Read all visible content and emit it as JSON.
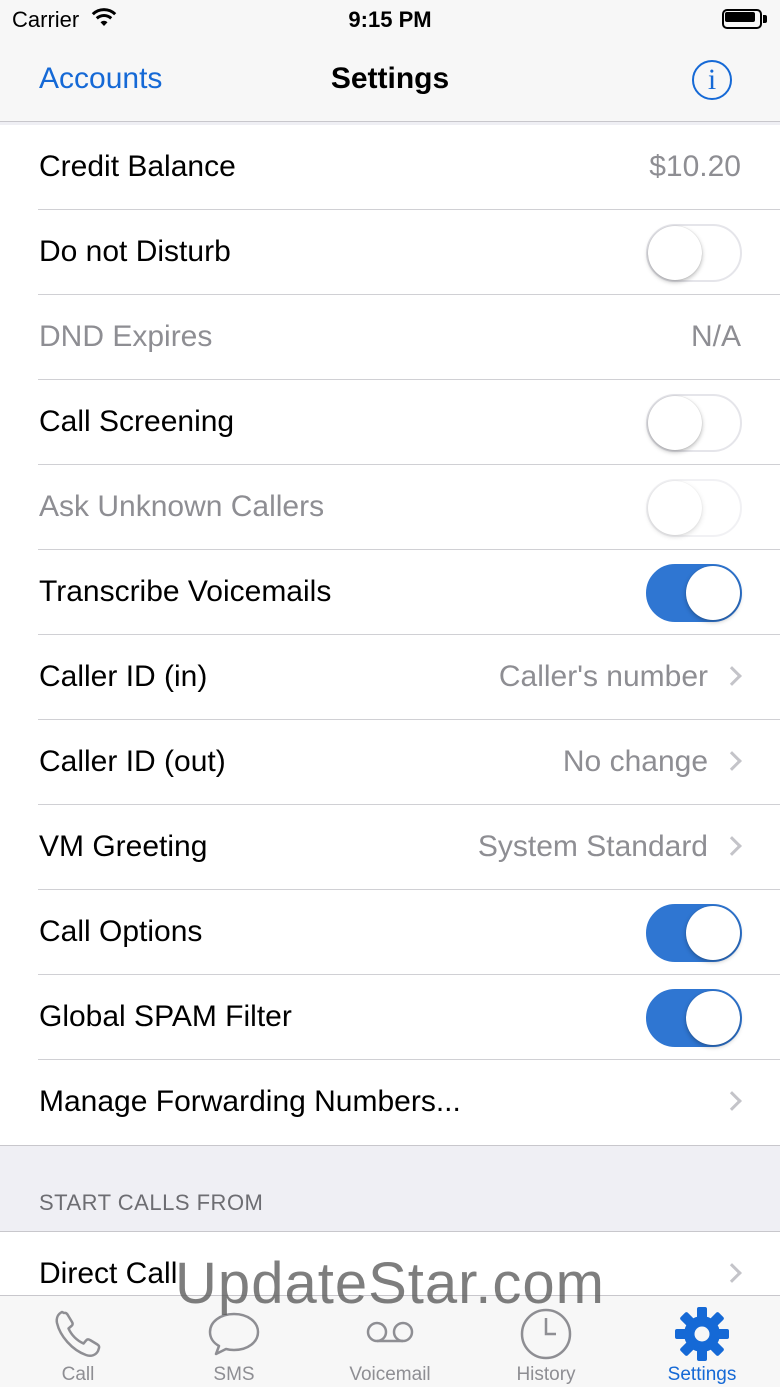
{
  "status": {
    "carrier": "Carrier",
    "time": "9:15 PM"
  },
  "nav": {
    "back_label": "Accounts",
    "title": "Settings",
    "info_glyph": "i"
  },
  "settings": [
    {
      "label": "Credit Balance",
      "value": "$10.20",
      "type": "value"
    },
    {
      "label": "Do not Disturb",
      "type": "toggle",
      "on": false
    },
    {
      "label": "DND Expires",
      "value": "N/A",
      "type": "value",
      "disabled": true
    },
    {
      "label": "Call Screening",
      "type": "toggle",
      "on": false
    },
    {
      "label": "Ask Unknown Callers",
      "type": "toggle",
      "on": false,
      "disabled": true
    },
    {
      "label": "Transcribe Voicemails",
      "type": "toggle",
      "on": true
    },
    {
      "label": "Caller ID (in)",
      "value": "Caller's number",
      "type": "disclosure"
    },
    {
      "label": "Caller ID (out)",
      "value": "No change",
      "type": "disclosure"
    },
    {
      "label": "VM Greeting",
      "value": "System Standard",
      "type": "disclosure"
    },
    {
      "label": "Call Options",
      "type": "toggle",
      "on": true
    },
    {
      "label": "Global SPAM Filter",
      "type": "toggle",
      "on": true
    },
    {
      "label": "Manage Forwarding Numbers...",
      "type": "disclosure"
    }
  ],
  "section": {
    "header": "START CALLS FROM",
    "rows": [
      {
        "label": "Direct Call"
      }
    ]
  },
  "watermark": "UpdateStar.com",
  "tabs": [
    {
      "label": "Call",
      "icon": "phone-icon"
    },
    {
      "label": "SMS",
      "icon": "chat-bubble-icon"
    },
    {
      "label": "Voicemail",
      "icon": "voicemail-icon"
    },
    {
      "label": "History",
      "icon": "clock-icon"
    },
    {
      "label": "Settings",
      "icon": "gear-icon",
      "active": true
    }
  ],
  "colors": {
    "accent": "#1569d6",
    "toggle_on": "#2f76d2",
    "secondary_text": "#8e8e93"
  }
}
